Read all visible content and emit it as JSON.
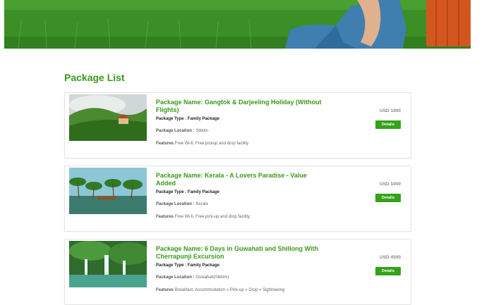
{
  "section": {
    "title": "Package List"
  },
  "packages": [
    {
      "name": "Package Name: Gangtok & Darjeeling Holiday (Without Flights)",
      "type_label": "Package Type : ",
      "type_value": "Family Package",
      "location_label": "Package Location : ",
      "location_value": "Sikkim",
      "features_label": "Features ",
      "features_value": "Free Wi-fi, Free pickup and drop facility",
      "price": "USD 1000",
      "details_label": "Details"
    },
    {
      "name": "Package Name: Kerala - A Lovers Paradise - Value Added",
      "type_label": "Package Type : ",
      "type_value": "Family Package",
      "location_label": "Package Location : ",
      "location_value": "Kerala",
      "features_label": "Features ",
      "features_value": "Free Wi-fi, Free pick-up and drop facility.",
      "price": "USD 1000",
      "details_label": "Details"
    },
    {
      "name": "Package Name: 6 Days in Guwahati and Shillong With Cherrapunji Excursion",
      "type_label": "Package Type : ",
      "type_value": "Family Package",
      "location_label": "Package Location : ",
      "location_value": "Guwahati(Sikkim)",
      "features_label": "Features ",
      "features_value": "Breakfast, Accommodation » Pick-up » Drop » Sightseeing",
      "price": "USD 4500",
      "details_label": "Details"
    }
  ]
}
